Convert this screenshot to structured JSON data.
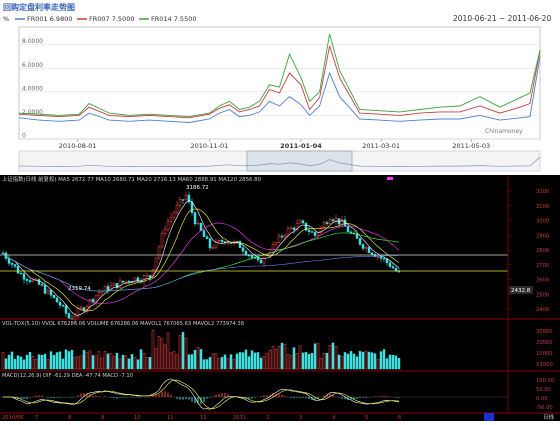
{
  "title": "回购定盘利率走势图",
  "rate_chart": {
    "y_unit": "%",
    "date_range": "2010-06-21 ~ 2011-06-20",
    "watermark": "Chinamoney",
    "legend": [
      {
        "name": "FR001",
        "value": "6.9800",
        "color": "#4f7fd0"
      },
      {
        "name": "FR007",
        "value": "7.5000",
        "color": "#c04040"
      },
      {
        "name": "FR014",
        "value": "7.5500",
        "color": "#40a040"
      }
    ],
    "y_ticks": [
      "0",
      "2.0000",
      "4.0000",
      "6.0000",
      "8.0000"
    ],
    "x_ticks": [
      "2010-08-01",
      "2010-11-01",
      "2011-01-04",
      "2011-03-01",
      "2011-05-03"
    ]
  },
  "chart_data": [
    {
      "type": "line",
      "title": "回购定盘利率走势图",
      "xlabel": "",
      "ylabel": "%",
      "ylim": [
        0,
        9.5
      ],
      "x": [
        "2010-06-21",
        "2010-07-05",
        "2010-07-19",
        "2010-08-02",
        "2010-08-09",
        "2010-08-23",
        "2010-09-06",
        "2010-09-20",
        "2010-10-04",
        "2010-10-18",
        "2010-11-01",
        "2010-11-08",
        "2010-11-15",
        "2010-11-22",
        "2010-11-29",
        "2010-12-06",
        "2010-12-13",
        "2010-12-20",
        "2010-12-27",
        "2011-01-04",
        "2011-01-10",
        "2011-01-17",
        "2011-01-24",
        "2011-01-31",
        "2011-02-14",
        "2011-02-28",
        "2011-03-14",
        "2011-03-28",
        "2011-04-11",
        "2011-04-25",
        "2011-05-09",
        "2011-05-23",
        "2011-06-06",
        "2011-06-13",
        "2011-06-20"
      ],
      "series": [
        {
          "name": "FR001",
          "values": [
            1.8,
            1.6,
            1.5,
            1.6,
            2.2,
            1.6,
            1.5,
            1.6,
            1.5,
            1.4,
            1.7,
            2.2,
            2.5,
            1.9,
            2.0,
            2.3,
            3.2,
            2.8,
            3.6,
            2.9,
            2.0,
            2.8,
            5.6,
            3.6,
            1.7,
            1.6,
            1.5,
            1.6,
            1.7,
            1.7,
            2.0,
            1.6,
            1.8,
            1.9,
            6.98
          ]
        },
        {
          "name": "FR007",
          "values": [
            2.1,
            2.0,
            1.9,
            2.0,
            2.7,
            2.0,
            1.9,
            2.0,
            1.9,
            1.8,
            2.1,
            2.6,
            2.9,
            2.3,
            2.5,
            2.8,
            4.2,
            3.9,
            5.6,
            4.6,
            2.5,
            3.5,
            7.9,
            5.2,
            2.2,
            2.1,
            2.0,
            2.2,
            2.3,
            2.3,
            2.8,
            2.2,
            2.7,
            3.0,
            7.5
          ]
        },
        {
          "name": "FR014",
          "values": [
            2.2,
            2.1,
            2.0,
            2.1,
            3.0,
            2.2,
            2.0,
            2.1,
            2.0,
            1.9,
            2.2,
            2.8,
            3.2,
            2.5,
            2.7,
            3.2,
            4.6,
            4.4,
            7.2,
            5.2,
            3.2,
            4.0,
            8.9,
            5.8,
            2.5,
            2.4,
            2.3,
            2.5,
            2.7,
            2.8,
            3.6,
            2.7,
            3.5,
            3.9,
            7.55
          ]
        }
      ]
    }
  ],
  "stock_chart": {
    "title_line": "上证指数(日线 前复权) MA5 2672.77  MA10 2680.71  MA20 2716.13  MA60 2888.91  MA120 2856.80",
    "annotations": {
      "high": "3186.72",
      "low": "2319.74",
      "last": "2432.8"
    },
    "price_ticks": [
      "3200",
      "3100",
      "3000",
      "2900",
      "2800",
      "2700",
      "2600",
      "2500",
      "2400"
    ],
    "volume_line": "VOL-TDX(5,10)  VVOL 676286.06  VOLUME 676286.06  MAVOL1 767065.63  MAVOL2 773974.38",
    "volume_ticks": [
      "30000",
      "20000",
      "10000",
      "X1000"
    ],
    "macd_line": "MACD(12,26,9)  DIF -61.29  DEA -47.74  MACD -7.10",
    "macd_ticks": [
      "100.00",
      "50.00",
      "0.00",
      "-50.00"
    ],
    "month_labels": [
      "2010/06",
      "7",
      "8",
      "9",
      "10",
      "11",
      "12",
      "2011",
      "2",
      "3",
      "4",
      "5",
      "6"
    ],
    "footer_right": "日线"
  }
}
